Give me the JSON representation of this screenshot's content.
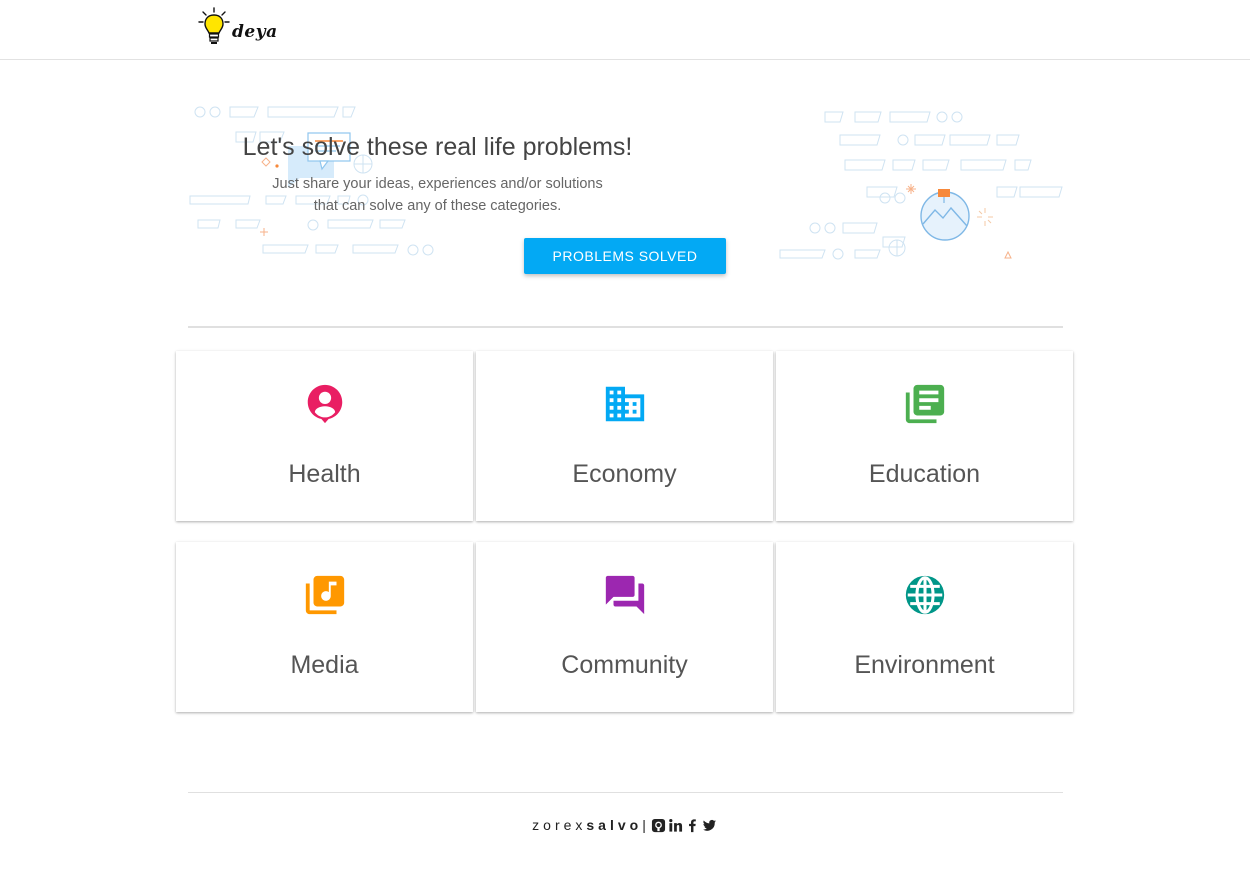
{
  "header": {
    "logo_text": "deya"
  },
  "hero": {
    "title": "Let's solve these real life problems!",
    "subtitle_line1": "Just share your ideas, experiences and/or solutions",
    "subtitle_line2": "that can solve any of these categories.",
    "button_label": "PROBLEMS SOLVED"
  },
  "categories": [
    {
      "label": "Health",
      "icon": "person-pin-icon",
      "color": "#e91e63"
    },
    {
      "label": "Economy",
      "icon": "business-icon",
      "color": "#03a9f4"
    },
    {
      "label": "Education",
      "icon": "library-books-icon",
      "color": "#4caf50"
    },
    {
      "label": "Media",
      "icon": "library-music-icon",
      "color": "#ff9800"
    },
    {
      "label": "Community",
      "icon": "forum-icon",
      "color": "#9c27b0"
    },
    {
      "label": "Environment",
      "icon": "globe-icon",
      "color": "#009688"
    }
  ],
  "footer": {
    "author_first": "zorex",
    "author_last": "salvo",
    "separator": "|",
    "social": [
      "github-icon",
      "linkedin-icon",
      "facebook-icon",
      "twitter-icon"
    ]
  },
  "colors": {
    "accent": "#03a9f4"
  }
}
